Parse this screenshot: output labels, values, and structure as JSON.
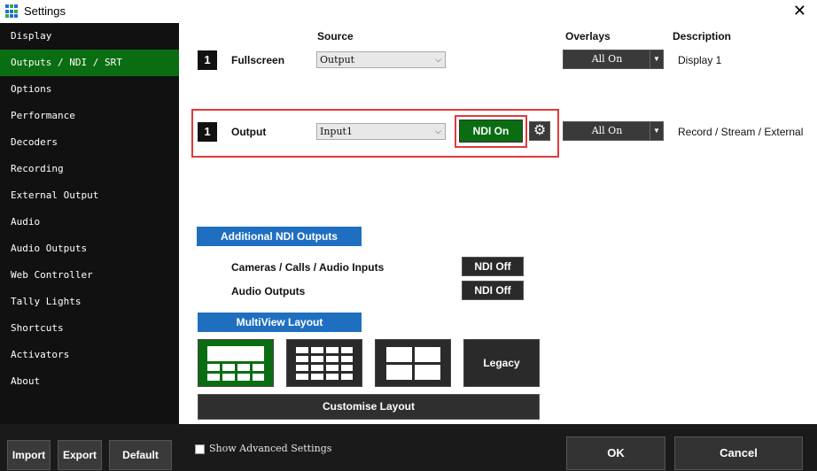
{
  "window": {
    "title": "Settings",
    "close_glyph": "✕",
    "icon": "app-grid-icon"
  },
  "sidebar": {
    "items": [
      {
        "label": "Display"
      },
      {
        "label": "Outputs / NDI / SRT",
        "active": true
      },
      {
        "label": "Options"
      },
      {
        "label": "Performance"
      },
      {
        "label": "Decoders"
      },
      {
        "label": "Recording"
      },
      {
        "label": "External Output"
      },
      {
        "label": "Audio"
      },
      {
        "label": "Audio Outputs"
      },
      {
        "label": "Web Controller"
      },
      {
        "label": "Tally Lights"
      },
      {
        "label": "Shortcuts"
      },
      {
        "label": "Activators"
      },
      {
        "label": "About"
      }
    ],
    "buttons": {
      "import": "Import",
      "export": "Export",
      "default": "Default"
    }
  },
  "columns": {
    "source": "Source",
    "overlays": "Overlays",
    "description": "Description"
  },
  "rows": [
    {
      "number": "1",
      "label": "Fullscreen",
      "source": "Output",
      "overlays": "All On",
      "description": "Display 1"
    },
    {
      "number": "1",
      "label": "Output",
      "source": "Input1",
      "ndi": "NDI On",
      "overlays": "All On",
      "description": "Record / Stream / External"
    }
  ],
  "additional_ndi": {
    "header": "Additional NDI Outputs",
    "items": [
      {
        "label": "Cameras / Calls / Audio Inputs",
        "status": "NDI Off"
      },
      {
        "label": "Audio Outputs",
        "status": "NDI Off"
      }
    ]
  },
  "multiview": {
    "header": "MultiView Layout",
    "legacy": "Legacy",
    "customise": "Customise Layout",
    "selected_index": 0
  },
  "footer": {
    "advanced": "Show Advanced Settings",
    "ok": "OK",
    "cancel": "Cancel"
  },
  "colors": {
    "accent_green": "#0b6d12",
    "header_blue": "#1f6fc0",
    "highlight_red": "#e03a3a",
    "sidebar_bg": "#111111"
  }
}
